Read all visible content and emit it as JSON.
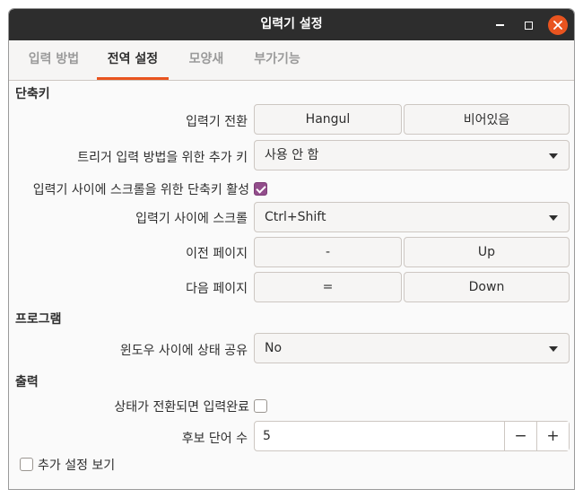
{
  "window": {
    "title": "입력기 설정"
  },
  "tabs": [
    {
      "label": "입력 방법"
    },
    {
      "label": "전역 설정"
    },
    {
      "label": "모양새"
    },
    {
      "label": "부가기능"
    }
  ],
  "shortcuts": {
    "section_title": "단축키",
    "trigger_label": "입력기 전환",
    "trigger_key1": "Hangul",
    "trigger_key2": "비어있음",
    "extra_key_label": "트리거 입력 방법을 위한 추가 키",
    "extra_key_value": "사용 안 함",
    "enable_scroll_label": "입력기 사이에 스크롤을 위한 단축키 활성",
    "enable_scroll_checked": true,
    "scroll_label": "입력기 사이에 스크롤",
    "scroll_value": "Ctrl+Shift",
    "prev_page_label": "이전 페이지",
    "prev_key1": "-",
    "prev_key2": "Up",
    "next_page_label": "다음 페이지",
    "next_key1": "=",
    "next_key2": "Down"
  },
  "program": {
    "section_title": "프로그램",
    "share_label": "윈도우 사이에 상태 공유",
    "share_value": "No"
  },
  "output": {
    "section_title": "출력",
    "commit_label": "상태가 전환되면 입력완료",
    "commit_checked": false,
    "candidates_label": "후보 단어 수",
    "candidates_value": "5",
    "minus": "−",
    "plus": "+"
  },
  "advanced": {
    "label": "추가 설정 보기",
    "checked": false
  }
}
